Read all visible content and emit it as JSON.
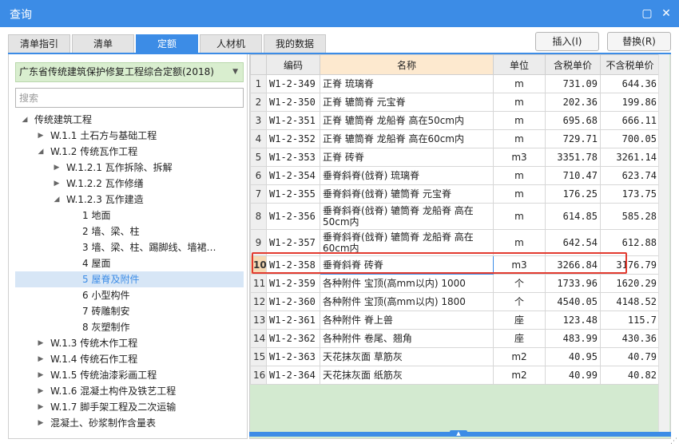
{
  "window": {
    "title": "查询",
    "restore_icon": "▢",
    "close_icon": "✕"
  },
  "tabs": [
    {
      "label": "清单指引",
      "active": false
    },
    {
      "label": "清单",
      "active": false
    },
    {
      "label": "定额",
      "active": true
    },
    {
      "label": "人材机",
      "active": false
    },
    {
      "label": "我的数据",
      "active": false
    }
  ],
  "actions": {
    "insert": "插入(I)",
    "replace": "替换(R)"
  },
  "left": {
    "quota_select": "广东省传统建筑保护修复工程综合定额(2018)",
    "search_placeholder": "搜索",
    "tree": [
      {
        "label": "传统建筑工程",
        "level": 0,
        "expanded": true
      },
      {
        "label": "W.1.1 土石方与基础工程",
        "level": 1,
        "expanded": false
      },
      {
        "label": "W.1.2 传统瓦作工程",
        "level": 1,
        "expanded": true
      },
      {
        "label": "W.1.2.1 瓦作拆除、拆解",
        "level": 2,
        "expanded": false
      },
      {
        "label": "W.1.2.2 瓦作修缮",
        "level": 2,
        "expanded": false
      },
      {
        "label": "W.1.2.3 瓦作建造",
        "level": 2,
        "expanded": true
      },
      {
        "label": "1 地面",
        "level": 3
      },
      {
        "label": "2 墙、梁、柱",
        "level": 3
      },
      {
        "label": "3 墙、梁、柱、踢脚线、墙裙、天...",
        "level": 3
      },
      {
        "label": "4 屋面",
        "level": 3
      },
      {
        "label": "5 屋脊及附件",
        "level": 3,
        "selected": true
      },
      {
        "label": "6 小型构件",
        "level": 3
      },
      {
        "label": "7 砖雕制安",
        "level": 3
      },
      {
        "label": "8 灰塑制作",
        "level": 3
      },
      {
        "label": "W.1.3 传统木作工程",
        "level": 1,
        "expanded": false
      },
      {
        "label": "W.1.4 传统石作工程",
        "level": 1,
        "expanded": false
      },
      {
        "label": "W.1.5 传统油漆彩画工程",
        "level": 1,
        "expanded": false
      },
      {
        "label": "W.1.6 混凝土构件及铁艺工程",
        "level": 1,
        "expanded": false
      },
      {
        "label": "W.1.7 脚手架工程及二次运输",
        "level": 1,
        "expanded": false
      },
      {
        "label": "混凝土、砂浆制作含量表",
        "level": 1,
        "expanded": false
      }
    ]
  },
  "grid": {
    "headers": [
      "",
      "编码",
      "名称",
      "单位",
      "含税单价",
      "不含税单价"
    ],
    "rows": [
      {
        "n": "1",
        "code": "W1-2-349",
        "name": "正脊 琉璃脊",
        "unit": "m",
        "price_tax": "731.09",
        "price_notax": "644.36"
      },
      {
        "n": "2",
        "code": "W1-2-350",
        "name": "正脊 辘筒脊 元宝脊",
        "unit": "m",
        "price_tax": "202.36",
        "price_notax": "199.86"
      },
      {
        "n": "3",
        "code": "W1-2-351",
        "name": "正脊 辘筒脊 龙船脊 高在50cm内",
        "unit": "m",
        "price_tax": "695.68",
        "price_notax": "666.11"
      },
      {
        "n": "4",
        "code": "W1-2-352",
        "name": "正脊 辘筒脊 龙船脊 高在60cm内",
        "unit": "m",
        "price_tax": "729.71",
        "price_notax": "700.05"
      },
      {
        "n": "5",
        "code": "W1-2-353",
        "name": "正脊 砖脊",
        "unit": "m3",
        "price_tax": "3351.78",
        "price_notax": "3261.14"
      },
      {
        "n": "6",
        "code": "W1-2-354",
        "name": "垂脊斜脊(戗脊) 琉璃脊",
        "unit": "m",
        "price_tax": "710.47",
        "price_notax": "623.74"
      },
      {
        "n": "7",
        "code": "W1-2-355",
        "name": "垂脊斜脊(戗脊) 辘筒脊 元宝脊",
        "unit": "m",
        "price_tax": "176.25",
        "price_notax": "173.75"
      },
      {
        "n": "8",
        "code": "W1-2-356",
        "name": "垂脊斜脊(戗脊) 辘筒脊 龙船脊 高在50cm内",
        "unit": "m",
        "price_tax": "614.85",
        "price_notax": "585.28",
        "tall": true
      },
      {
        "n": "9",
        "code": "W1-2-357",
        "name": "垂脊斜脊(戗脊) 辘筒脊 龙船脊 高在60cm内",
        "unit": "m",
        "price_tax": "642.54",
        "price_notax": "612.88",
        "tall": true
      },
      {
        "n": "10",
        "code": "W1-2-358",
        "name": "垂脊斜脊 砖脊",
        "unit": "m3",
        "price_tax": "3266.84",
        "price_notax": "3176.79",
        "current": true
      },
      {
        "n": "11",
        "code": "W1-2-359",
        "name": "各种附件 宝顶(高mm以内) 1000",
        "unit": "个",
        "price_tax": "1733.96",
        "price_notax": "1620.29"
      },
      {
        "n": "12",
        "code": "W1-2-360",
        "name": "各种附件 宝顶(高mm以内) 1800",
        "unit": "个",
        "price_tax": "4540.05",
        "price_notax": "4148.52"
      },
      {
        "n": "13",
        "code": "W1-2-361",
        "name": "各种附件 脊上兽",
        "unit": "座",
        "price_tax": "123.48",
        "price_notax": "115.7"
      },
      {
        "n": "14",
        "code": "W1-2-362",
        "name": "各种附件 卷尾、翘角",
        "unit": "座",
        "price_tax": "483.99",
        "price_notax": "430.36"
      },
      {
        "n": "15",
        "code": "W1-2-363",
        "name": "天花抹灰面 草筋灰",
        "unit": "m2",
        "price_tax": "40.95",
        "price_notax": "40.79"
      },
      {
        "n": "16",
        "code": "W1-2-364",
        "name": "天花抹灰面 纸筋灰",
        "unit": "m2",
        "price_tax": "40.99",
        "price_notax": "40.82"
      }
    ]
  },
  "colors": {
    "accent": "#3c8ce6",
    "highlight": "#e23a2f",
    "select_bg": "#d9eecf",
    "grid_empty": "#d3ead0"
  }
}
